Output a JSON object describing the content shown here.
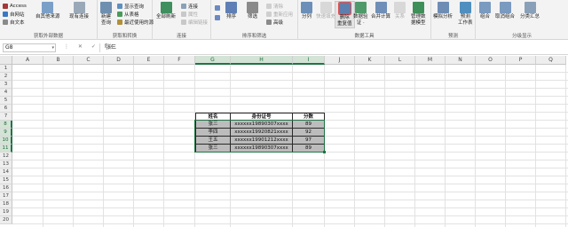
{
  "ribbon": {
    "get_external": {
      "label": "获取外部数据",
      "items": [
        "Access",
        "自网站",
        "自文本"
      ],
      "other_sources": "自其他来源",
      "existing": "现有连接"
    },
    "get_transform": {
      "label": "获取和转换",
      "new_query": "新建\n查询",
      "items": [
        "显示查询",
        "从表格",
        "最近使用的源"
      ]
    },
    "connections": {
      "label": "连接",
      "refresh_all": "全部刷新",
      "items": [
        "连接",
        "属性",
        "编辑链接"
      ]
    },
    "sort_filter": {
      "label": "排序和筛选",
      "sort": "排序",
      "filter": "筛选",
      "items": [
        "清除",
        "重新应用",
        "高级"
      ]
    },
    "data_tools": {
      "label": "数据工具",
      "split": "分列",
      "flash_fill": "快速填充",
      "remove_dup": "删除\n重复值",
      "validation": "数据验\n证 ·",
      "consolidate": "合并计算",
      "relations": "关系",
      "data_model": "管理数\n据模型"
    },
    "forecast": {
      "label": "预测",
      "what_if": "模拟分析",
      "forecast_sheet": "预测\n工作表"
    },
    "outline": {
      "label": "分级显示",
      "group": "组合",
      "ungroup": "取消组合",
      "subtotal": "分类汇总"
    }
  },
  "formula_bar": {
    "name_box": "G8",
    "fx_icons": "⋮ ✕ ✓ fx",
    "content": "张三"
  },
  "grid": {
    "columns": [
      "A",
      "B",
      "C",
      "D",
      "E",
      "F",
      "G",
      "H",
      "I",
      "J",
      "K",
      "L",
      "M",
      "N",
      "O",
      "P",
      "Q"
    ],
    "rows": [
      "1",
      "2",
      "3",
      "4",
      "5",
      "6",
      "7",
      "8",
      "9",
      "10",
      "11",
      "12",
      "13",
      "14",
      "15",
      "16",
      "17",
      "18",
      "19",
      "20"
    ],
    "selected_columns": [
      "G",
      "H",
      "I"
    ],
    "selected_rows": [
      "8",
      "9",
      "10",
      "11"
    ]
  },
  "table": {
    "headers": [
      "姓名",
      "身份证号",
      "分数"
    ],
    "rows": [
      [
        "张三",
        "xxxxxx19890307xxxx",
        "89"
      ],
      [
        "李四",
        "xxxxxx19920821xxxx",
        "92"
      ],
      [
        "王五",
        "xxxxxx19901212xxxx",
        "97"
      ],
      [
        "张三",
        "xxxxxx19890307xxxx",
        "89"
      ]
    ]
  },
  "colors": {
    "accent_green": "#217346",
    "selection_fill": "#bcbcbc",
    "ribbon_bg": "#f3f3f3"
  }
}
